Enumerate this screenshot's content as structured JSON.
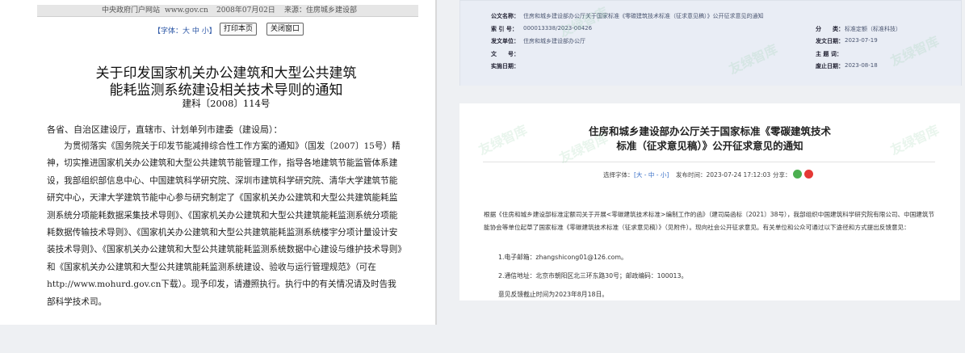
{
  "left_doc": {
    "meta": {
      "source": "中央政府门户网站",
      "site": "www.gov.cn",
      "date": "2008年07月02日",
      "from": "来源：住房城乡建设部"
    },
    "font_size_label": "【字体：大 中 小】",
    "print_button": "打印本页",
    "close_button": "关闭窗口",
    "title_line1": "关于印发国家机关办公建筑和大型公共建筑",
    "title_line2": "能耗监测系统建设相关技术导则的通知",
    "doc_number": "建科〔2008〕114号",
    "salutation": "各省、自治区建设厅，直辖市、计划单列市建委（建设局）：",
    "body": "　　为贯彻落实《国务院关于印发节能减排综合性工作方案的通知》（国发〔2007〕15号）精神，切实推进国家机关办公建筑和大型公共建筑节能管理工作，指导各地建筑节能监管体系建设，我部组织部信息中心、中国建筑科学研究院、深圳市建筑科学研究院、清华大学建筑节能研究中心，天津大学建筑节能中心参与研究制定了《国家机关办公建筑和大型公共建筑能耗监测系统分项能耗数据采集技术导则》、《国家机关办公建筑和大型公共建筑能耗监测系统分项能耗数据传输技术导则》、《国家机关办公建筑和大型公共建筑能耗监测系统楼宇分项计量设计安装技术导则》、《国家机关办公建筑和大型公共建筑能耗监测系统数据中心建设与维护技术导则》和《国家机关办公建筑和大型公共建筑能耗监测系统建设、验收与运行管理规范》（可在\nhttp://www.mohurd.gov.cn下载）。现予印发，请遵照执行。执行中的有关情况请及时告我部科学技术司。"
  },
  "right_doc": {
    "meta": {
      "doc_name_key": "公文名称：",
      "doc_name_val": "住房和城乡建设部办公厅关于国家标准《零碳建筑技术标准（征求意见稿）》公开征求意见的通知",
      "index_key": "索 引 号：",
      "index_val": "000013338/2023-00426",
      "issuer_key": "发文单位：",
      "issuer_val": "住房和城乡建设部办公厅",
      "docnum_key": "文　　号：",
      "docnum_val": "",
      "impl_key": "实施日期：",
      "impl_val": "",
      "class_key": "分　　类：",
      "class_val": "标准定额（标准科技）",
      "pub_date_key": "发文日期：",
      "pub_date_val": "2023-07-19",
      "topic_key": "主 题 词：",
      "topic_val": "",
      "expire_key": "废止日期：",
      "expire_val": "2023-08-18"
    },
    "title_line1": "住房和城乡建设部办公厅关于国家标准《零碳建筑技术",
    "title_line2": "标准（征求意见稿）》公开征求意见的通知",
    "font_select_label": "选择字体：",
    "font_select_options": "[大 - 中 - 小]",
    "publish_time": "发布时间：2023-07-24 17:12:03",
    "share_label": "分享：",
    "share_colors": {
      "wechat": "#4caf50",
      "weibo": "#e53935"
    },
    "paragraph": "根据《住房和城乡建设部标准定额司关于开展<零碳建筑技术标准>编制工作的函》（建司局函标〔2021〕38号），我部组织中国建筑科学研究院有限公司、中国建筑节能协会等单位起草了国家标准《零碳建筑技术标准（征求意见稿）》（见附件）。现向社会公开征求意见。有关单位和公众可通过以下途径和方式提出反馈意见：",
    "item1": "1.电子邮箱：zhangshicong01@126.com。",
    "item2": "2.通信地址：北京市朝阳区北三环东路30号；邮政编码：100013。",
    "deadline": "意见反馈截止时间为2023年8月18日。",
    "watermark": "友绿智库"
  }
}
